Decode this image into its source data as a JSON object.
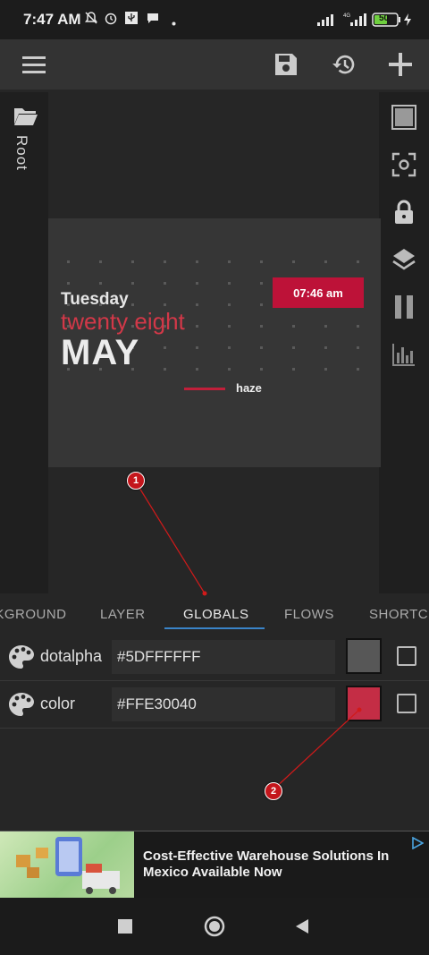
{
  "status_bar": {
    "time": "7:47 AM",
    "battery": "50"
  },
  "toolbar": {
    "menu_icon": "menu-icon",
    "save_icon": "save-icon",
    "history_icon": "history-icon",
    "add_icon": "add-icon"
  },
  "left_rail": {
    "label": "Root",
    "icon": "folder-icon"
  },
  "right_rail": [
    "square-icon",
    "focus-icon",
    "lock-icon",
    "layers-icon",
    "pause-icon",
    "chart-icon"
  ],
  "preview": {
    "day": "Tuesday",
    "date": "twenty eight",
    "month": "MAY",
    "clock": "07:46 am",
    "haze": "haze"
  },
  "tabs": {
    "background": "BACKGROUND",
    "layer": "LAYER",
    "globals": "GLOBALS",
    "flows": "FLOWS",
    "shortcuts": "SHORTCUTS",
    "active": "GLOBALS"
  },
  "globals": [
    {
      "name": "dotalpha",
      "value": "#5DFFFFFF",
      "swatch": "#575757"
    },
    {
      "name": "color",
      "value": "#FFE30040",
      "swatch": "#c42d45"
    }
  ],
  "markers": [
    "1",
    "2"
  ],
  "ad": {
    "text": "Cost-Effective Warehouse Solutions In Mexico Available Now"
  },
  "colors": {
    "accent": "#c11f3a",
    "tab_underline": "#3a84c9"
  }
}
